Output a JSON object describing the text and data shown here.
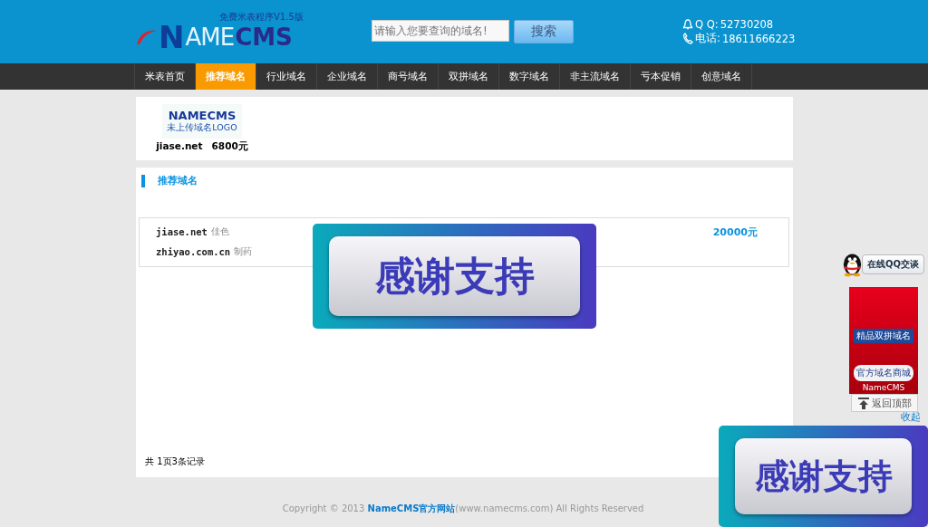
{
  "header": {
    "logo": {
      "letter": "N",
      "text_a": "AME",
      "text_b": "CMS",
      "tagline": "免费米表程序V1.5版"
    },
    "search": {
      "placeholder": "请输入您要查询的域名!",
      "button": "搜索"
    },
    "contacts": [
      {
        "kind": "qq",
        "label": "Q Q:",
        "value": "52730208"
      },
      {
        "kind": "phone",
        "label": "电话:",
        "value": "18611666223"
      }
    ]
  },
  "nav": [
    {
      "label": "米表首页",
      "selected": false
    },
    {
      "label": "推荐域名",
      "selected": true
    },
    {
      "label": "行业域名",
      "selected": false
    },
    {
      "label": "企业域名",
      "selected": false
    },
    {
      "label": "商号域名",
      "selected": false
    },
    {
      "label": "双拼域名",
      "selected": false
    },
    {
      "label": "数字域名",
      "selected": false
    },
    {
      "label": "非主流域名",
      "selected": false
    },
    {
      "label": "亏本促销",
      "selected": false
    },
    {
      "label": "创意域名",
      "selected": false
    }
  ],
  "featured": [
    {
      "logo_title": "NAMECMS",
      "logo_caption": "未上传域名LOGO",
      "domain": "jiase.net",
      "price": "6800元"
    }
  ],
  "section": {
    "title": "推荐域名",
    "domains": [
      {
        "domain": "jiase.net",
        "tag": "佳色"
      },
      {
        "price": "20000元"
      },
      {
        "domain": "zhiyao.com.cn",
        "tag": "制药"
      }
    ],
    "pager": "共 1页3条记录"
  },
  "side": {
    "qq_button": "在线QQ交谈",
    "banner": {
      "sign": "精品双拼域名",
      "button": "官方域名商城",
      "brand": "NameCMS"
    },
    "back_to_top": "返回顶部",
    "collapse": "收起"
  },
  "ads": [
    {
      "text": "感谢支持"
    },
    {
      "text": "感谢支持"
    }
  ],
  "footer": {
    "prefix": "Copyright © 2013",
    "link": "NameCMS官方网站",
    "suffix": "(www.namecms.com) All Rights Reserved"
  }
}
